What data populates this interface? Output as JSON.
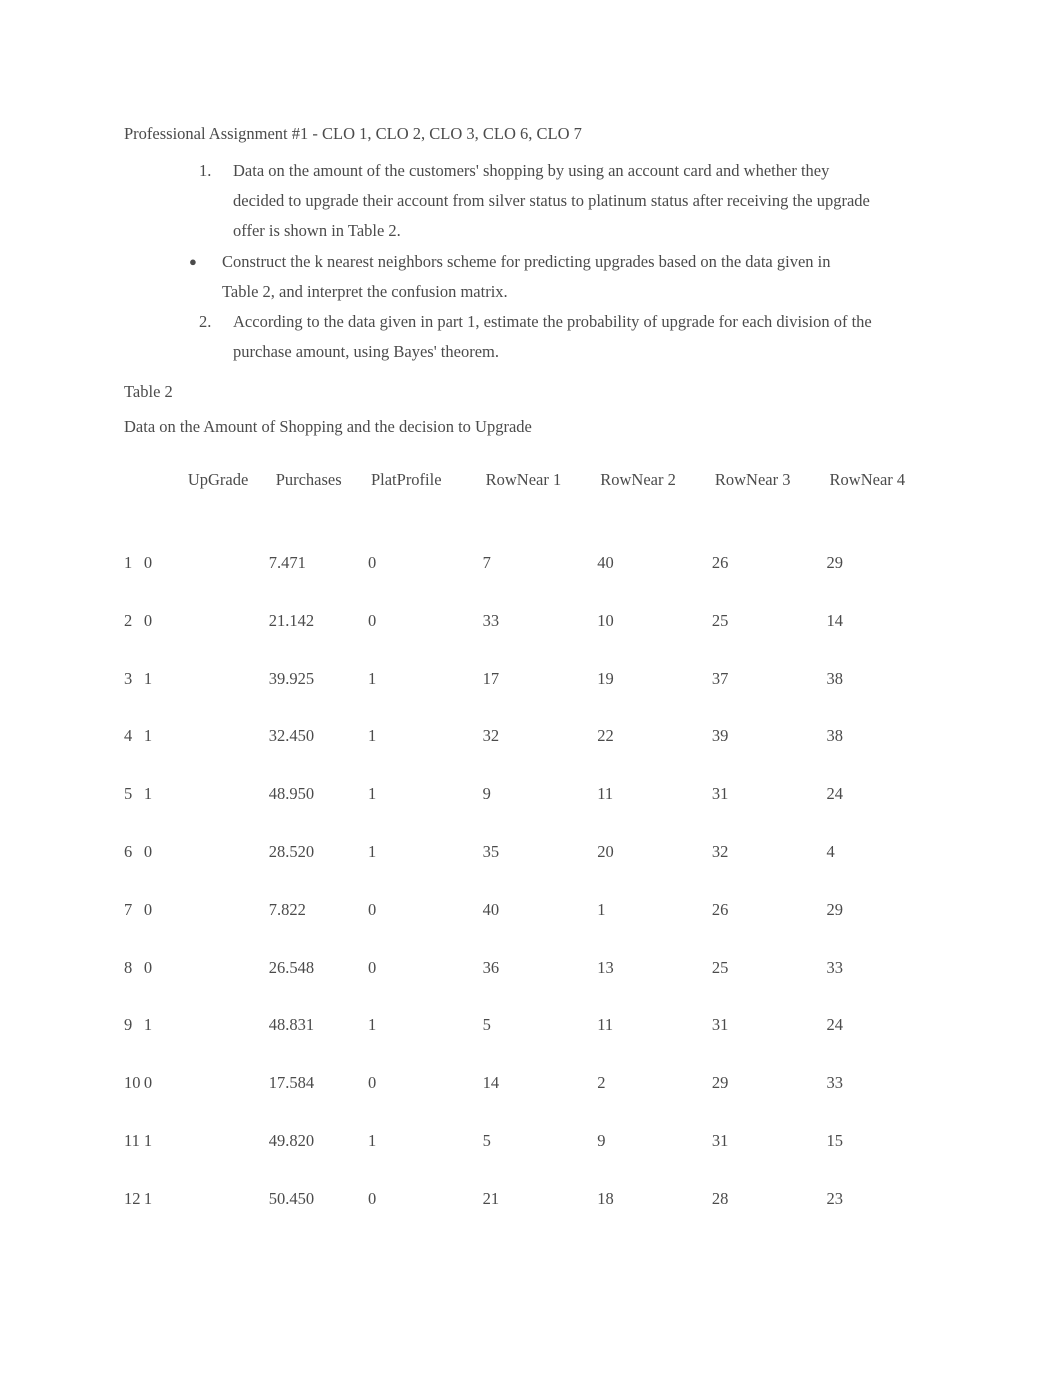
{
  "document": {
    "title": "Professional Assignment #1 - CLO 1, CLO 2, CLO 3, CLO 6, CLO 7",
    "items": [
      {
        "marker": "1.",
        "type": "number",
        "text": "Data on the amount of the customers' shopping by using an account card and whether they decided to upgrade their account from silver status to platinum status after receiving the upgrade offer is shown in Table 2."
      },
      {
        "marker": "●",
        "type": "bullet",
        "text": "Construct the k nearest neighbors scheme for predicting upgrades based on the data given in Table 2, and interpret the confusion matrix."
      },
      {
        "marker": "2.",
        "type": "number",
        "text": "According to the data given in part 1, estimate the probability of upgrade for each division of the purchase amount, using Bayes' theorem."
      }
    ],
    "table_label": "Table 2",
    "table_caption": "Data on the Amount of Shopping and the decision to Upgrade"
  },
  "table": {
    "index_header": "",
    "columns": [
      "UpGrade",
      "Purchases",
      "PlatProfile",
      "RowNear 1",
      "RowNear 2",
      "RowNear 3",
      "RowNear 4"
    ],
    "rows": [
      {
        "index": "1",
        "UpGrade": "0",
        "Purchases": "7.471",
        "PlatProfile": "0",
        "RowNear1": "7",
        "RowNear2": "40",
        "RowNear3": "26",
        "RowNear4": "29"
      },
      {
        "index": "2",
        "UpGrade": "0",
        "Purchases": "21.142",
        "PlatProfile": "0",
        "RowNear1": "33",
        "RowNear2": "10",
        "RowNear3": "25",
        "RowNear4": "14"
      },
      {
        "index": "3",
        "UpGrade": "1",
        "Purchases": "39.925",
        "PlatProfile": "1",
        "RowNear1": "17",
        "RowNear2": "19",
        "RowNear3": "37",
        "RowNear4": "38"
      },
      {
        "index": "4",
        "UpGrade": "1",
        "Purchases": "32.450",
        "PlatProfile": "1",
        "RowNear1": "32",
        "RowNear2": "22",
        "RowNear3": "39",
        "RowNear4": "38"
      },
      {
        "index": "5",
        "UpGrade": "1",
        "Purchases": "48.950",
        "PlatProfile": "1",
        "RowNear1": "9",
        "RowNear2": "11",
        "RowNear3": "31",
        "RowNear4": "24"
      },
      {
        "index": "6",
        "UpGrade": "0",
        "Purchases": "28.520",
        "PlatProfile": "1",
        "RowNear1": "35",
        "RowNear2": "20",
        "RowNear3": "32",
        "RowNear4": "4"
      },
      {
        "index": "7",
        "UpGrade": "0",
        "Purchases": "7.822",
        "PlatProfile": "0",
        "RowNear1": "40",
        "RowNear2": "1",
        "RowNear3": "26",
        "RowNear4": "29"
      },
      {
        "index": "8",
        "UpGrade": "0",
        "Purchases": "26.548",
        "PlatProfile": "0",
        "RowNear1": "36",
        "RowNear2": "13",
        "RowNear3": "25",
        "RowNear4": "33"
      },
      {
        "index": "9",
        "UpGrade": "1",
        "Purchases": "48.831",
        "PlatProfile": "1",
        "RowNear1": "5",
        "RowNear2": "11",
        "RowNear3": "31",
        "RowNear4": "24"
      },
      {
        "index": "10",
        "UpGrade": "0",
        "Purchases": "17.584",
        "PlatProfile": "0",
        "RowNear1": "14",
        "RowNear2": "2",
        "RowNear3": "29",
        "RowNear4": "33"
      },
      {
        "index": "11",
        "UpGrade": "1",
        "Purchases": "49.820",
        "PlatProfile": "1",
        "RowNear1": "5",
        "RowNear2": "9",
        "RowNear3": "31",
        "RowNear4": "15"
      },
      {
        "index": "12",
        "UpGrade": "1",
        "Purchases": "50.450",
        "PlatProfile": "0",
        "RowNear1": "21",
        "RowNear2": "18",
        "RowNear3": "28",
        "RowNear4": "23"
      }
    ]
  },
  "colors": {
    "text": "#4b4b4b",
    "background": "#ffffff"
  }
}
